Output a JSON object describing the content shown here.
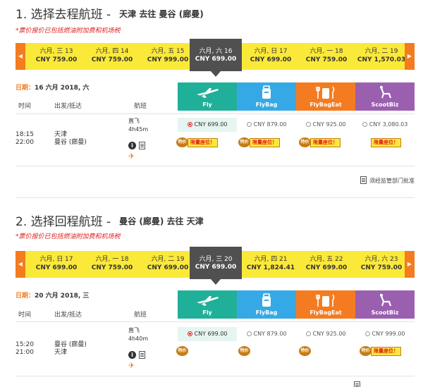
{
  "outbound": {
    "title": "1. 选择去程航班 -",
    "route": "天津 去往 曼谷 (廊曼)",
    "note": "*票价报价已包括燃油附加费和机场税",
    "dates": [
      {
        "date": "六月, 三 13",
        "price": "CNY 759.00"
      },
      {
        "date": "六月, 四 14",
        "price": "CNY 759.00"
      },
      {
        "date": "六月, 五 15",
        "price": "CNY 999.00"
      },
      {
        "date": "六月, 六 16",
        "price": "CNY 699.00"
      },
      {
        "date": "六月, 日 17",
        "price": "CNY 699.00"
      },
      {
        "date": "六月, 一 18",
        "price": "CNY 759.00"
      },
      {
        "date": "六月, 二 19",
        "price": "CNY 1,570.03"
      }
    ],
    "date_label": "日期：",
    "date_value": "16 六月 2018, 六",
    "headers": {
      "time": "时间",
      "depart_arrive": "出发/抵达",
      "flight": "航班"
    },
    "flight": {
      "depart_time": "18:15",
      "arrive_time": "22:00",
      "from": "天津",
      "to": "曼谷 (廊曼)",
      "type": "直飞",
      "duration": "4h45m"
    },
    "prices": [
      "CNY 699.00",
      "CNY 879.00",
      "CNY 925.00",
      "CNY 3,080.03"
    ],
    "footer_note": "须经监管部门批准"
  },
  "inbound": {
    "title": "2. 选择回程航班 -",
    "route": "曼谷 (廊曼) 去往 天津",
    "note": "*票价报价已包括燃油附加费和机场税",
    "dates": [
      {
        "date": "六月, 日 17",
        "price": "CNY 699.00"
      },
      {
        "date": "六月, 一 18",
        "price": "CNY 759.00"
      },
      {
        "date": "六月, 二 19",
        "price": "CNY 699.00"
      },
      {
        "date": "六月, 三 20",
        "price": "CNY 699.00"
      },
      {
        "date": "六月, 四 21",
        "price": "CNY 1,824.41"
      },
      {
        "date": "六月, 五 22",
        "price": "CNY 699.00"
      },
      {
        "date": "六月, 六 23",
        "price": "CNY 759.00"
      }
    ],
    "date_label": "日期：",
    "date_value": "20 六月 2018, 三",
    "headers": {
      "time": "时间",
      "depart_arrive": "出发/抵达",
      "flight": "航班"
    },
    "flight": {
      "depart_time": "15:20",
      "arrive_time": "21:00",
      "from": "曼谷 (廊曼)",
      "to": "天津",
      "type": "直飞",
      "duration": "4h40m"
    },
    "prices": [
      "CNY 699.00",
      "CNY 879.00",
      "CNY 925.00",
      "CNY 999.00"
    ]
  },
  "fares": [
    "Fly",
    "FlyBag",
    "FlyBagEat",
    "ScootBiz"
  ],
  "badges": {
    "promo": "特价",
    "limited": "限量座位！"
  },
  "icons": {
    "prev": "chevron-left-icon",
    "next": "chevron-right-icon",
    "fly": "airplane-icon",
    "flybag": "luggage-icon",
    "flybageat": "meal-icon",
    "scootbiz": "seat-icon",
    "info": "info-icon",
    "doc": "document-icon",
    "plane": "plane-icon"
  },
  "colors": {
    "accent_orange": "#f47b20",
    "date_bar_yellow": "#fbe93a",
    "selected_dark": "#505050",
    "fly": "#20b09a",
    "flybag": "#35a9e6",
    "flybageat": "#f47b20",
    "scootbiz": "#9b5fb0",
    "note_red": "#e02020"
  }
}
